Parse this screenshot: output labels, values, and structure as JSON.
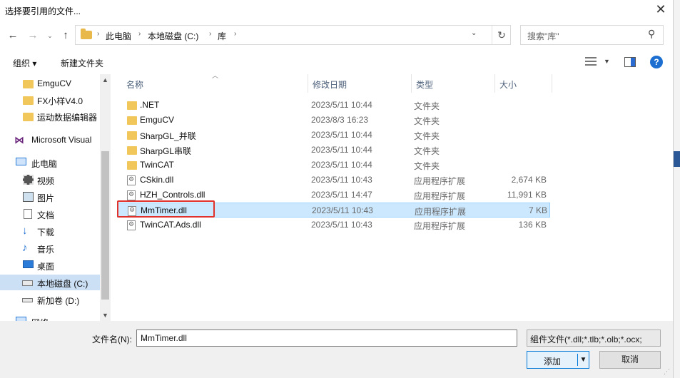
{
  "window": {
    "title": "选择要引用的文件..."
  },
  "nav": {
    "breadcrumbs": [
      "此电脑",
      "本地磁盘 (C:)",
      "库"
    ],
    "search_placeholder": "搜索\"库\""
  },
  "toolbar": {
    "organize": "组织 ▾",
    "new_folder": "新建文件夹"
  },
  "sidebar": {
    "items": [
      {
        "label": "EmguCV",
        "icon": "folder-icon"
      },
      {
        "label": "FX小样V4.0",
        "icon": "folder-icon"
      },
      {
        "label": "运动数据编辑器",
        "icon": "folder-icon"
      },
      {
        "label": "Microsoft Visual",
        "icon": "visual-studio-icon"
      },
      {
        "label": "此电脑",
        "icon": "computer-icon"
      },
      {
        "label": "视频",
        "icon": "video-icon"
      },
      {
        "label": "图片",
        "icon": "picture-icon"
      },
      {
        "label": "文档",
        "icon": "document-icon"
      },
      {
        "label": "下载",
        "icon": "download-icon"
      },
      {
        "label": "音乐",
        "icon": "music-icon"
      },
      {
        "label": "桌面",
        "icon": "desktop-icon"
      },
      {
        "label": "本地磁盘 (C:)",
        "icon": "drive-icon"
      },
      {
        "label": "新加卷 (D:)",
        "icon": "drive-icon"
      },
      {
        "label": "网络",
        "icon": "network-icon"
      }
    ]
  },
  "columns": {
    "name": "名称",
    "date": "修改日期",
    "type": "类型",
    "size": "大小"
  },
  "files": [
    {
      "name": ".NET",
      "date": "2023/5/11 10:44",
      "type": "文件夹",
      "size": "",
      "icon": "folder"
    },
    {
      "name": "EmguCV",
      "date": "2023/8/3 16:23",
      "type": "文件夹",
      "size": "",
      "icon": "folder"
    },
    {
      "name": "SharpGL_并联",
      "date": "2023/5/11 10:44",
      "type": "文件夹",
      "size": "",
      "icon": "folder"
    },
    {
      "name": "SharpGL串联",
      "date": "2023/5/11 10:44",
      "type": "文件夹",
      "size": "",
      "icon": "folder"
    },
    {
      "name": "TwinCAT",
      "date": "2023/5/11 10:44",
      "type": "文件夹",
      "size": "",
      "icon": "folder"
    },
    {
      "name": "CSkin.dll",
      "date": "2023/5/11 10:43",
      "type": "应用程序扩展",
      "size": "2,674 KB",
      "icon": "dll"
    },
    {
      "name": "HZH_Controls.dll",
      "date": "2023/5/11 14:47",
      "type": "应用程序扩展",
      "size": "11,991 KB",
      "icon": "dll"
    },
    {
      "name": "MmTimer.dll",
      "date": "2023/5/11 10:43",
      "type": "应用程序扩展",
      "size": "7 KB",
      "icon": "dll",
      "selected": true
    },
    {
      "name": "TwinCAT.Ads.dll",
      "date": "2023/5/11 10:43",
      "type": "应用程序扩展",
      "size": "136 KB",
      "icon": "dll"
    }
  ],
  "bottom": {
    "filename_label": "文件名(N):",
    "filename_value": "MmTimer.dll",
    "filetype": "组件文件(*.dll;*.tlb;*.olb;*.ocx;",
    "open_label": "添加",
    "cancel_label": "取消"
  },
  "colors": {
    "accent": "#0078d7",
    "selection": "#cce8ff",
    "highlight_box": "#e0312a"
  }
}
